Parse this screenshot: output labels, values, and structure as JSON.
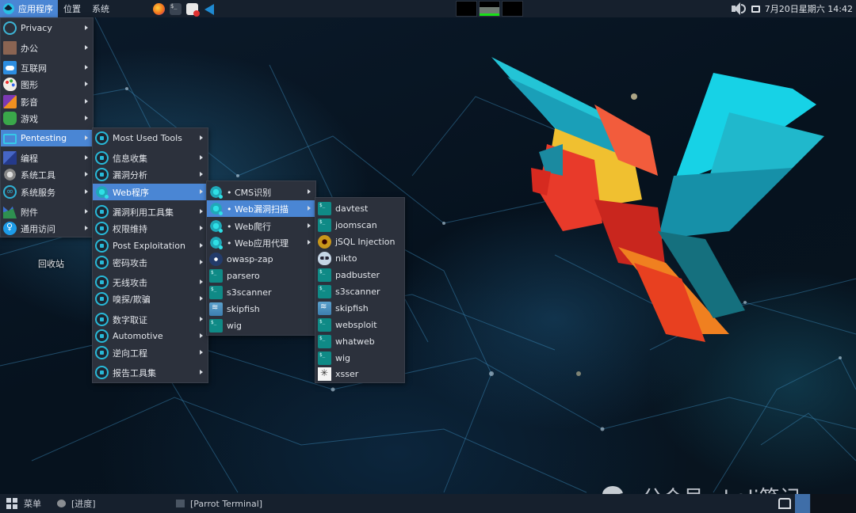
{
  "top_panel": {
    "apps_label": "应用程序",
    "menus": [
      "位置",
      "系统"
    ],
    "launchers": [
      "firefox-icon",
      "terminal-icon",
      "text-editor-icon",
      "vscode-icon"
    ],
    "cpu_graph_levels": [
      0.0,
      0.6,
      0.0
    ],
    "datetime": "7月20日星期六 14:42",
    "colors": {
      "panel_bg": "#16202d",
      "accent": "#4a86d4"
    }
  },
  "main_menu": {
    "items": [
      {
        "label": "Privacy",
        "icon": "privacy-icon",
        "submenu": true
      },
      {
        "label": "办公",
        "icon": "office-icon",
        "submenu": true
      },
      {
        "label": "互联网",
        "icon": "internet-icon",
        "submenu": true
      },
      {
        "label": "图形",
        "icon": "graphics-icon",
        "submenu": true
      },
      {
        "label": "影音",
        "icon": "media-icon",
        "submenu": true
      },
      {
        "label": "游戏",
        "icon": "games-icon",
        "submenu": true
      },
      {
        "label": "Pentesting",
        "icon": "pentesting-icon",
        "submenu": true,
        "selected": true
      },
      {
        "label": "编程",
        "icon": "programming-icon",
        "submenu": true
      },
      {
        "label": "系统工具",
        "icon": "system-tools-icon",
        "submenu": true
      },
      {
        "label": "系统服务",
        "icon": "system-services-icon",
        "submenu": true
      },
      {
        "label": "附件",
        "icon": "accessories-icon",
        "submenu": true
      },
      {
        "label": "通用访问",
        "icon": "accessibility-icon",
        "submenu": true
      }
    ]
  },
  "pentesting_menu": {
    "items": [
      {
        "label": "Most Used Tools",
        "icon": "most-used-icon",
        "submenu": true
      },
      {
        "label": "信息收集",
        "icon": "info-gathering-icon",
        "submenu": true
      },
      {
        "label": "漏洞分析",
        "icon": "vuln-analysis-icon",
        "submenu": true
      },
      {
        "label": "Web程序",
        "icon": "web-apps-icon",
        "submenu": true,
        "selected": true
      },
      {
        "label": "漏洞利用工具集",
        "icon": "exploitation-icon",
        "submenu": true
      },
      {
        "label": "权限维持",
        "icon": "persistence-icon",
        "submenu": true
      },
      {
        "label": "Post Exploitation",
        "icon": "post-exploitation-icon",
        "submenu": true
      },
      {
        "label": "密码攻击",
        "icon": "password-attack-icon",
        "submenu": true
      },
      {
        "label": "无线攻击",
        "icon": "wireless-icon",
        "submenu": true
      },
      {
        "label": "嗅探/欺骗",
        "icon": "sniffing-icon",
        "submenu": true
      },
      {
        "label": "数字取证",
        "icon": "forensics-icon",
        "submenu": true
      },
      {
        "label": "Automotive",
        "icon": "automotive-icon",
        "submenu": true
      },
      {
        "label": "逆向工程",
        "icon": "reverse-engineering-icon",
        "submenu": true
      },
      {
        "label": "报告工具集",
        "icon": "reporting-icon",
        "submenu": true
      }
    ]
  },
  "web_menu": {
    "items": [
      {
        "label": "• CMS识别",
        "icon": "web-icon",
        "submenu": true
      },
      {
        "label": "• Web漏洞扫描",
        "icon": "web-icon",
        "submenu": true,
        "selected": true
      },
      {
        "label": "• Web爬行",
        "icon": "web-icon",
        "submenu": true
      },
      {
        "label": "• Web应用代理",
        "icon": "web-icon",
        "submenu": true
      },
      {
        "label": "owasp-zap",
        "icon": "owasp-zap-icon",
        "submenu": false
      },
      {
        "label": "parsero",
        "icon": "terminal-tile-icon",
        "submenu": false
      },
      {
        "label": "s3scanner",
        "icon": "terminal-tile-icon",
        "submenu": false
      },
      {
        "label": "skipfish",
        "icon": "skipfish-icon",
        "submenu": false
      },
      {
        "label": "wig",
        "icon": "terminal-tile-icon",
        "submenu": false
      }
    ]
  },
  "scanner_menu": {
    "items": [
      {
        "label": "davtest",
        "icon": "terminal-tile-icon"
      },
      {
        "label": "joomscan",
        "icon": "terminal-tile-icon"
      },
      {
        "label": "jSQL Injection",
        "icon": "jsql-icon"
      },
      {
        "label": "nikto",
        "icon": "nikto-icon"
      },
      {
        "label": "padbuster",
        "icon": "terminal-tile-icon"
      },
      {
        "label": "s3scanner",
        "icon": "terminal-tile-icon"
      },
      {
        "label": "skipfish",
        "icon": "skipfish-icon"
      },
      {
        "label": "websploit",
        "icon": "terminal-tile-icon"
      },
      {
        "label": "whatweb",
        "icon": "terminal-tile-icon"
      },
      {
        "label": "wig",
        "icon": "terminal-tile-icon"
      },
      {
        "label": "xsser",
        "icon": "xsser-icon"
      }
    ]
  },
  "desktop": {
    "trash_label": "回收站",
    "watermark": "公众号 · kali笔记"
  },
  "bottom_panel": {
    "menu_label": "菜单",
    "tasks": [
      "[进度]",
      "[Parrot Terminal]"
    ],
    "workspaces": 3,
    "active_workspace": 1
  }
}
